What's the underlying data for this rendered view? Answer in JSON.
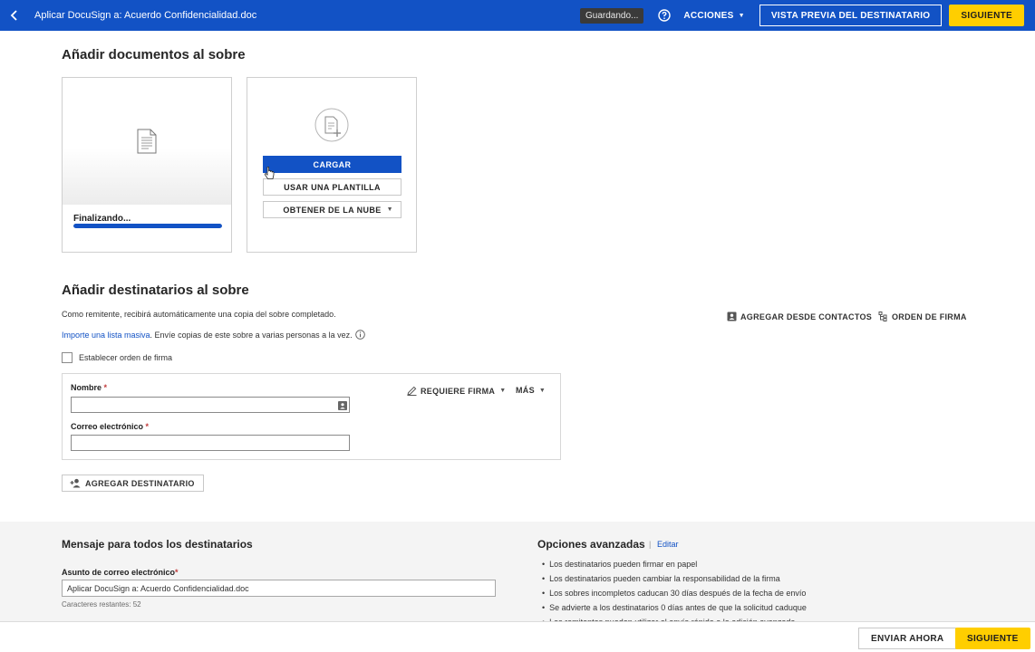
{
  "topbar": {
    "doc_title": "Aplicar DocuSign a: Acuerdo Confidencialidad.doc",
    "saving_status": "Guardando...",
    "actions_label": "ACCIONES",
    "preview_label": "VISTA PREVIA DEL DESTINATARIO",
    "next_label": "SIGUIENTE"
  },
  "documents": {
    "title": "Añadir documentos al sobre",
    "doc_card": {
      "status": "Finalizando...",
      "progress_fraction": 1.0
    },
    "upload_card": {
      "upload_label": "CARGAR",
      "template_label": "USAR UNA PLANTILLA",
      "cloud_label": "OBTENER DE LA NUBE"
    }
  },
  "recipients": {
    "title": "Añadir destinatarios al sobre",
    "copy_note": "Como remitente, recibirá automáticamente una copia del sobre completado.",
    "bulk_link": "Importe una lista masiva",
    "bulk_text": ". Envíe copias de este sobre a varias personas a la vez.",
    "add_from_contacts": "AGREGAR DESDE CONTACTOS",
    "signing_order": "ORDEN DE FIRMA",
    "set_order_label": "Establecer orden de firma",
    "name_label": "Nombre",
    "email_label": "Correo electrónico",
    "required_mark": "*",
    "name_value": "",
    "email_value": "",
    "requires_sign_label": "REQUIERE FIRMA",
    "more_label": "MÁS",
    "add_recipient_label": "AGREGAR DESTINATARIO"
  },
  "message": {
    "title": "Mensaje para todos los destinatarios",
    "subject_label": "Asunto de correo electrónico",
    "subject_value": "Aplicar DocuSign a: Acuerdo Confidencialidad.doc",
    "remaining_chars": "Caracteres restantes: 52"
  },
  "advanced": {
    "title": "Opciones avanzadas",
    "separator": "|",
    "edit_label": "Editar",
    "items": [
      "Los destinatarios pueden firmar en papel",
      "Los destinatarios pueden cambiar la responsabilidad de la firma",
      "Los sobres incompletos caducan 30 días después de la fecha de envío",
      "Se advierte a los destinatarios 0 días antes de que la solicitud caduque",
      "Los remitentes pueden utilizar el envío rápido o la edición avanzada"
    ]
  },
  "footer": {
    "send_now_label": "ENVIAR AHORA",
    "next_label": "SIGUIENTE"
  },
  "colors": {
    "brand": "#1252c5",
    "accent": "#ffce00"
  }
}
